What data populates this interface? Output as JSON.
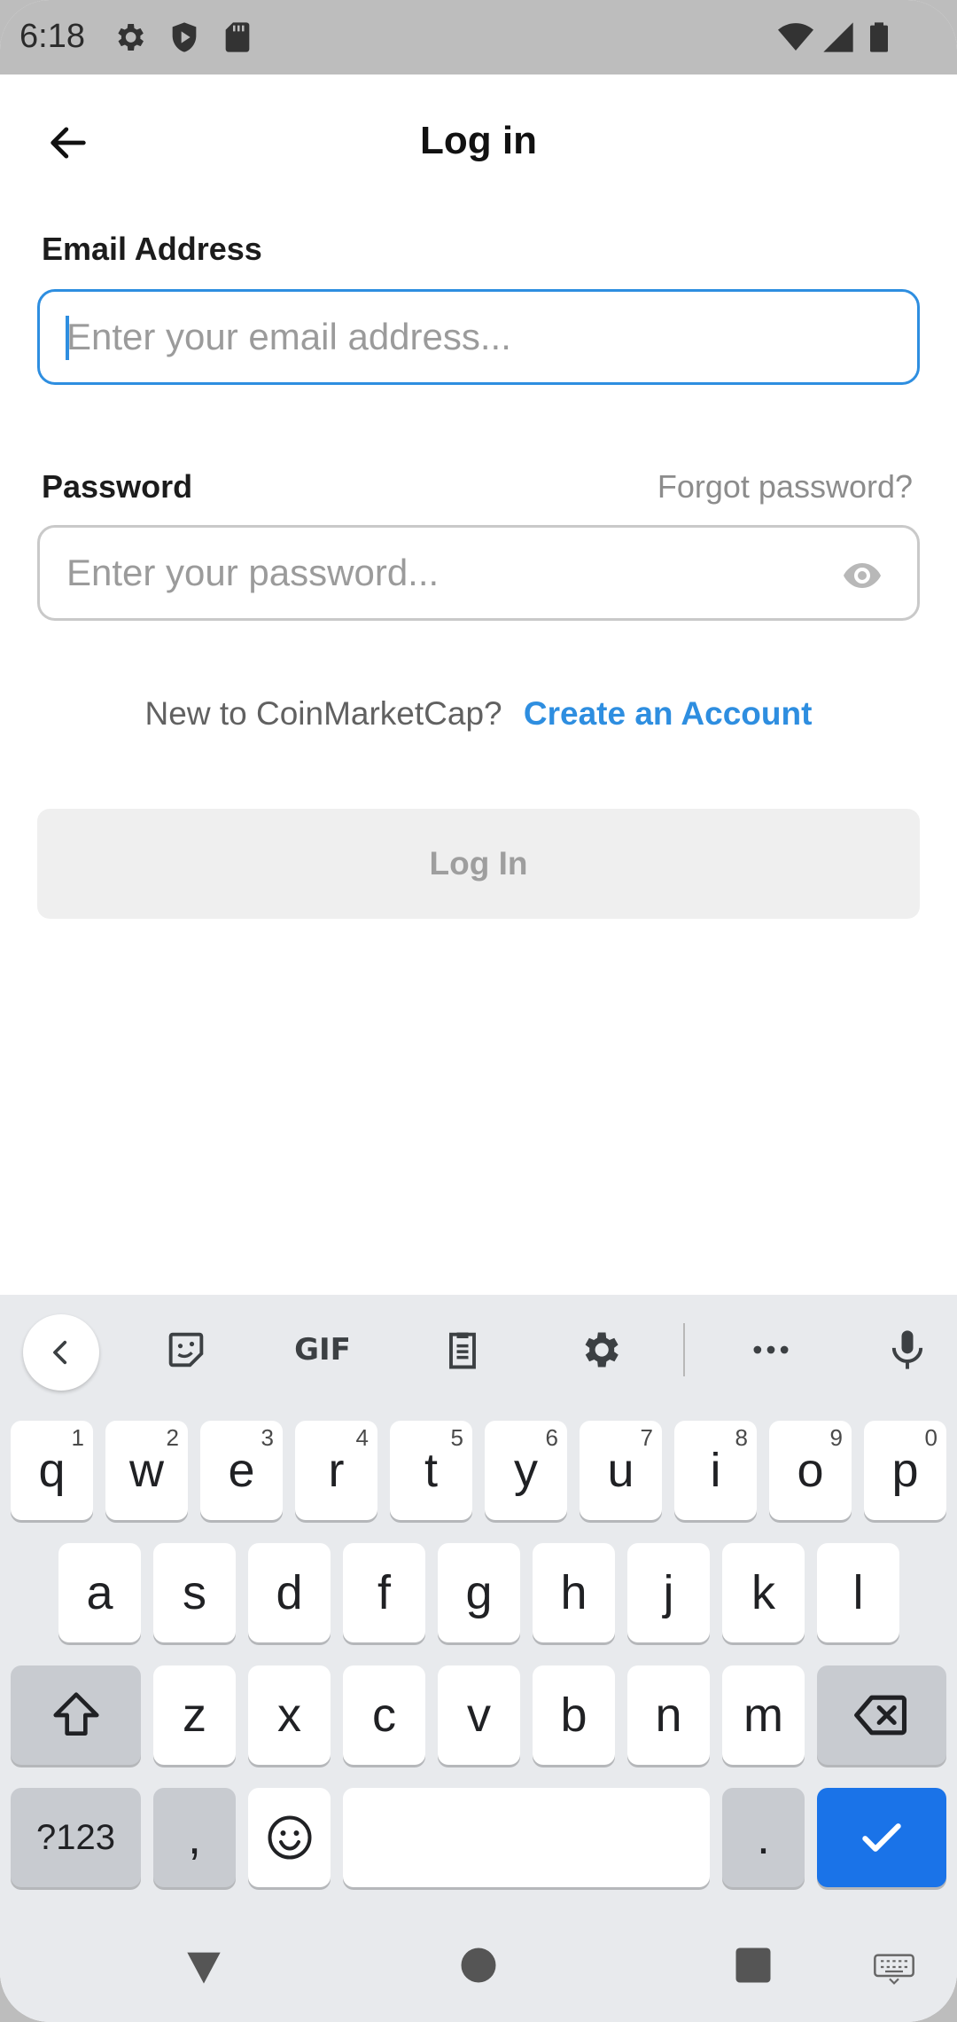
{
  "status_bar": {
    "time": "6:18"
  },
  "header": {
    "title": "Log in"
  },
  "form": {
    "email_label": "Email Address",
    "email_placeholder": "Enter your email address...",
    "password_label": "Password",
    "forgot_label": "Forgot password?",
    "password_placeholder": "Enter your password...",
    "signup_question": "New to CoinMarketCap?",
    "signup_link": "Create an Account",
    "login_button": "Log In"
  },
  "keyboard": {
    "toolbar": {
      "gif_label": "GIF"
    },
    "row1": [
      {
        "key": "q",
        "hint": "1"
      },
      {
        "key": "w",
        "hint": "2"
      },
      {
        "key": "e",
        "hint": "3"
      },
      {
        "key": "r",
        "hint": "4"
      },
      {
        "key": "t",
        "hint": "5"
      },
      {
        "key": "y",
        "hint": "6"
      },
      {
        "key": "u",
        "hint": "7"
      },
      {
        "key": "i",
        "hint": "8"
      },
      {
        "key": "o",
        "hint": "9"
      },
      {
        "key": "p",
        "hint": "0"
      }
    ],
    "row2": [
      "a",
      "s",
      "d",
      "f",
      "g",
      "h",
      "j",
      "k",
      "l"
    ],
    "row3": [
      "z",
      "x",
      "c",
      "v",
      "b",
      "n",
      "m"
    ],
    "row4": {
      "symbols": "?123",
      "comma": ",",
      "period": "."
    }
  },
  "colors": {
    "accent": "#2e8ee0",
    "keyboard_action": "#1a73e8"
  }
}
